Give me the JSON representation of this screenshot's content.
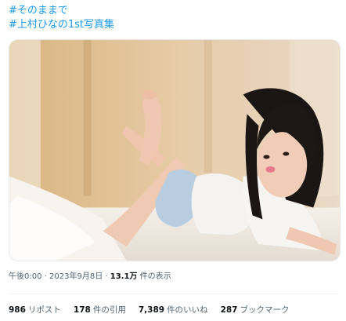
{
  "tweet": {
    "hashtags": [
      "#そのままで",
      "#上村ひなの1st写真集"
    ],
    "media": {
      "alt": "photo"
    },
    "meta": {
      "time": "午後0:00",
      "sep1": " · ",
      "date": "2023年9月8日",
      "sep2": " · ",
      "views_count": "13.1万",
      "views_label": " 件の表示"
    },
    "stats": [
      {
        "count": "986",
        "label": "リポスト"
      },
      {
        "count": "178",
        "label": "件の引用"
      },
      {
        "count": "7,389",
        "label": "件のいいね"
      },
      {
        "count": "287",
        "label": "ブックマーク"
      }
    ]
  },
  "colors": {
    "link": "#1d9bf0",
    "secondary_text": "#536471",
    "primary_text": "#0f1419"
  }
}
